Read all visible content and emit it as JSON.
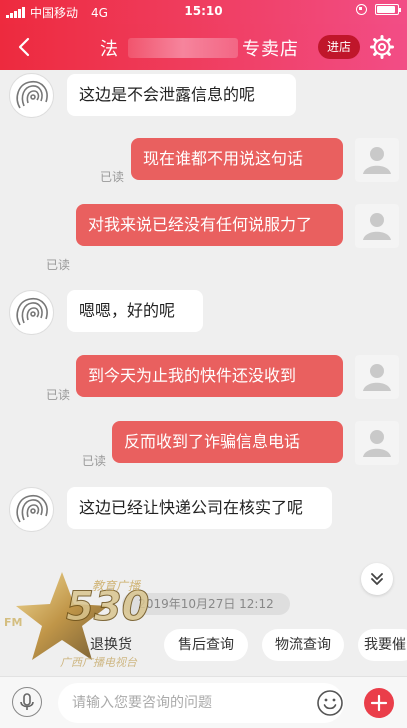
{
  "status_bar": {
    "carrier": "中国移动",
    "network": "4G",
    "time": "15:10",
    "battery_level": 0.9
  },
  "nav": {
    "title_start": "法",
    "title_end": "专卖店",
    "enter_shop_label": "进店"
  },
  "messages": [
    {
      "side": "in",
      "text": "这边是不会泄露信息的呢"
    },
    {
      "side": "out",
      "text": "现在谁都不用说这句话",
      "read_label": "已读"
    },
    {
      "side": "out",
      "text": "对我来说已经没有任何说服力了",
      "read_label": "已读"
    },
    {
      "side": "in",
      "text": "嗯嗯，好的呢"
    },
    {
      "side": "out",
      "text": "到今天为止我的快件还没收到",
      "read_label": "已读"
    },
    {
      "side": "out",
      "text": "反而收到了诈骗信息电话",
      "read_label": "已读"
    },
    {
      "side": "in",
      "text": "这边已经让快递公司在核实了呢"
    }
  ],
  "timestamp": "2019年10月27日 12:12",
  "quick_chips": [
    "退换货",
    "售后查询",
    "物流查询",
    "我要催"
  ],
  "input": {
    "placeholder": "请输入您要咨询的问题"
  },
  "colors": {
    "brand_red": "#ef3450",
    "out_bubble": "#e9605f",
    "read_gray": "#999999"
  },
  "icons": [
    "back-arrow-icon",
    "gear-icon",
    "chevron-double-down-icon",
    "microphone-icon",
    "emoji-icon",
    "plus-icon"
  ]
}
